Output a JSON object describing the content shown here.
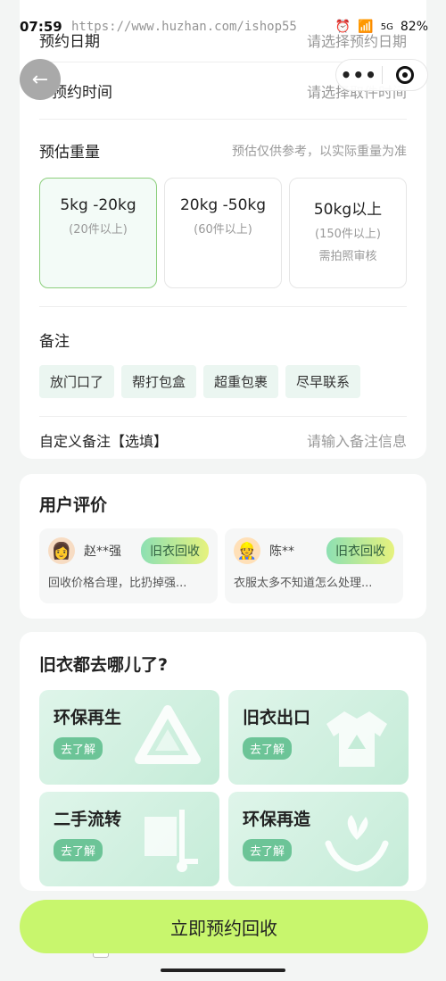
{
  "status": {
    "time": "07:59",
    "battery": "82%",
    "signal": "5G",
    "watermark": "https://www.huzhan.com/ishop55"
  },
  "header": {
    "back_icon": "arrow-left-icon",
    "more_icon": "more-dots-icon",
    "close_icon": "target-icon"
  },
  "form": {
    "date_label": "预约日期",
    "date_value": "请选择预约日期",
    "time_label": "预约时间",
    "time_value": "请选择取件时间",
    "weight_label": "预估重量",
    "weight_hint": "预估仅供参考，以实际重量为准",
    "weights": [
      {
        "main": "5kg -20kg",
        "sub": "(20件以上)",
        "sub2": "",
        "selected": true
      },
      {
        "main": "20kg -50kg",
        "sub": "(60件以上)",
        "sub2": "",
        "selected": false
      },
      {
        "main": "50kg以上",
        "sub": "(150件以上)",
        "sub2": "需拍照审核",
        "selected": false
      }
    ],
    "note_label": "备注",
    "tags": [
      "放门口了",
      "帮打包盒",
      "超重包裹",
      "尽早联系"
    ],
    "custom_label": "自定义备注【选填】",
    "custom_value": "请输入备注信息"
  },
  "reviews": {
    "title": "用户评价",
    "items": [
      {
        "name": "赵**强",
        "badge": "旧衣回收",
        "text": "回收价格合理，比扔掉强..."
      },
      {
        "name": "陈**",
        "badge": "旧衣回收",
        "text": "衣服太多不知道怎么处理..."
      }
    ]
  },
  "destinations": {
    "title": "旧衣都去哪儿了?",
    "button_label": "去了解",
    "items": [
      {
        "title": "环保再生",
        "icon": "recycle-icon"
      },
      {
        "title": "旧衣出口",
        "icon": "sweater-icon"
      },
      {
        "title": "二手流转",
        "icon": "hand-truck-icon"
      },
      {
        "title": "环保再造",
        "icon": "plant-hands-icon"
      }
    ]
  },
  "cta": {
    "label": "立即预约回收"
  },
  "colors": {
    "accent": "#c8f66d",
    "green": "#6cc497",
    "selected_border": "#8ccf7d"
  }
}
